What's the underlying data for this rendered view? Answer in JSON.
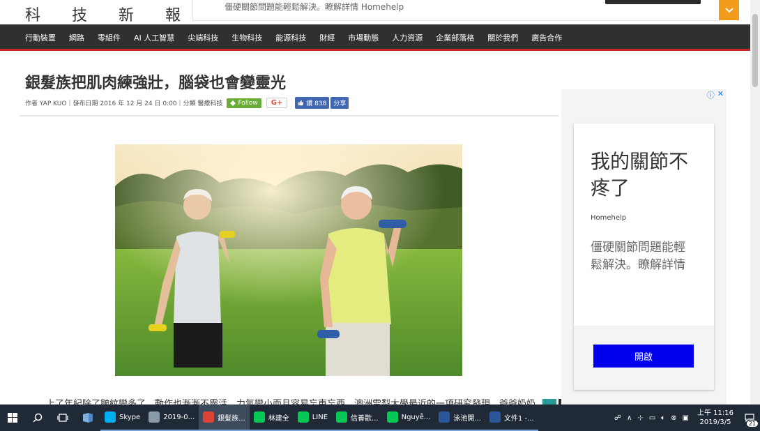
{
  "site": {
    "title": "科 技 新 報"
  },
  "top_ad": {
    "text": "僵硬關節問題能輕鬆解決。瞭解詳情 Homehelp"
  },
  "nav": {
    "items": [
      "行動裝置",
      "網路",
      "零組件",
      "AI 人工智慧",
      "尖端科技",
      "生物科技",
      "能源科技",
      "財經",
      "市場動態",
      "人力資源",
      "企業部落格",
      "關於我們",
      "廣告合作"
    ]
  },
  "article": {
    "title": "銀髮族把肌肉練強壯，腦袋也會變靈光",
    "author": "作者 YAP KUO",
    "date": "發布日期 2016 年 12 月 24 日 0:00",
    "category": "分類 醫療科技",
    "follow_label": "Follow",
    "gplus_label": "G+",
    "like_label": "讚 838",
    "share_label": "分享",
    "body_first_line": "上了年紀除了皺紋變多了，動作也漸漸不靈活，力氣變小而且容易忘東忘西，澳洲雪梨大學最近的一項研究發現，爺爺奶奶"
  },
  "side_ad": {
    "headline": "我的關節不疼了",
    "brand": "Homehelp",
    "description": "僵硬關節問題能輕鬆解決。瞭解詳情",
    "button_label": "開啟",
    "button_color": "#0000ee"
  },
  "taskbar": {
    "apps": [
      {
        "label": "Skype",
        "color": "#00aff0"
      },
      {
        "label": "2019-0...",
        "color": "#8a9aa8"
      },
      {
        "label": "銀髮族...",
        "color": "#db4437"
      },
      {
        "label": "林建全",
        "color": "#06c755"
      },
      {
        "label": "LINE",
        "color": "#06c755"
      },
      {
        "label": "信善歡...",
        "color": "#06c755"
      },
      {
        "label": "Nguyễ...",
        "color": "#06c755"
      },
      {
        "label": "泳池開...",
        "color": "#2b579a"
      },
      {
        "label": "文件1 -...",
        "color": "#2b579a"
      }
    ],
    "time": "上午 11:16",
    "date": "2019/3/5",
    "notification_count": "21"
  },
  "colors": {
    "nav_bg": "#303030",
    "nav_accent": "#c9252b",
    "chevron_orange": "#f29b1d",
    "taskbar_bg": "#1f2a36"
  }
}
